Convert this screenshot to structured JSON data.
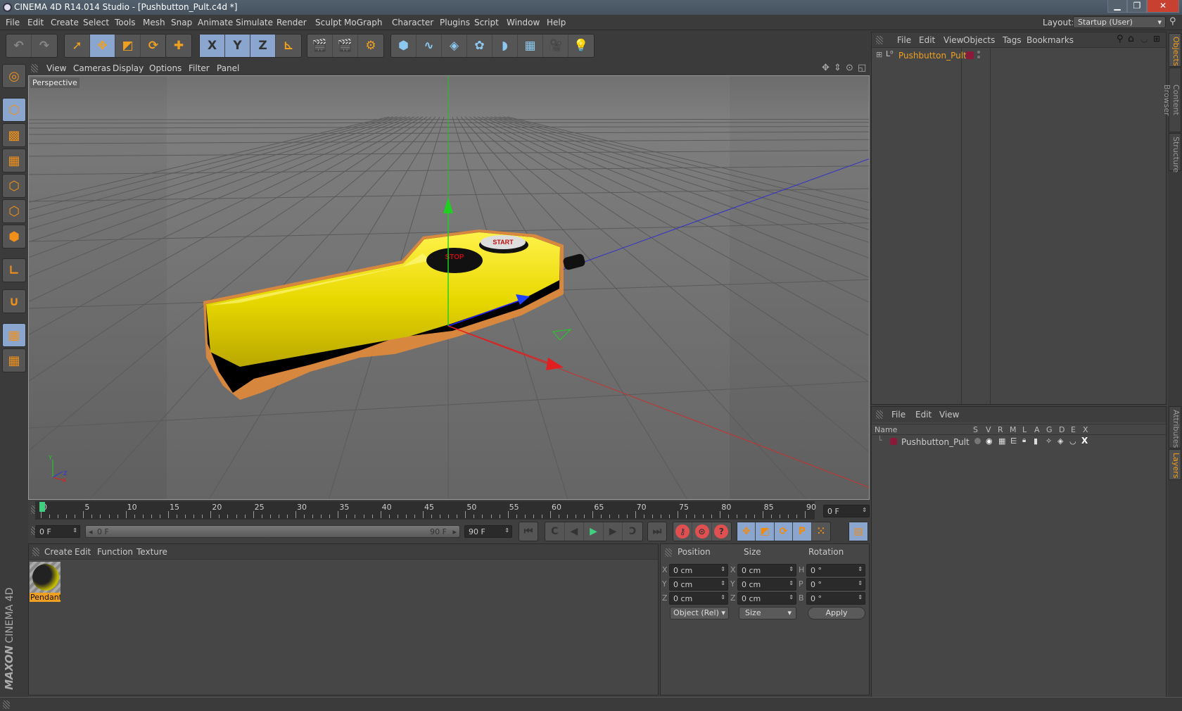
{
  "window": {
    "title": "CINEMA 4D R14.014 Studio - [Pushbutton_Pult.c4d *]",
    "minimize": "▁",
    "restore": "❐",
    "close": "✕"
  },
  "menubar": [
    "File",
    "Edit",
    "Create",
    "Select",
    "Tools",
    "Mesh",
    "Snap",
    "Animate",
    "Simulate",
    "Render",
    "Sculpt",
    "MoGraph",
    "Character",
    "Plugins",
    "Script",
    "Window",
    "Help"
  ],
  "layout": {
    "label": "Layout:",
    "value": "Startup (User)"
  },
  "toolbar": {
    "undo_group": [
      {
        "name": "undo-icon",
        "glyph": "↶"
      },
      {
        "name": "redo-icon",
        "glyph": "↷"
      }
    ],
    "transform_group": [
      {
        "name": "live-selection-icon",
        "glyph": "➚",
        "selected": false
      },
      {
        "name": "move-icon",
        "glyph": "✥",
        "selected": true
      },
      {
        "name": "scale-icon",
        "glyph": "◩",
        "selected": false
      },
      {
        "name": "rotate-icon",
        "glyph": "⟳",
        "selected": false
      }
    ],
    "last_tool": [
      {
        "name": "last-tool-icon",
        "glyph": "✚"
      }
    ],
    "axis_group": [
      {
        "name": "x-axis-lock-icon",
        "glyph": "X",
        "selected": true
      },
      {
        "name": "y-axis-lock-icon",
        "glyph": "Y",
        "selected": true
      },
      {
        "name": "z-axis-lock-icon",
        "glyph": "Z",
        "selected": true
      },
      {
        "name": "coordinate-system-icon",
        "glyph": "⊾",
        "selected": false
      }
    ],
    "render_group": [
      {
        "name": "render-view-icon",
        "glyph": "🎬"
      },
      {
        "name": "render-picture-viewer-icon",
        "glyph": "🎬"
      },
      {
        "name": "render-settings-icon",
        "glyph": "⚙"
      }
    ],
    "object_group": [
      {
        "name": "cube-icon",
        "glyph": "⬢"
      },
      {
        "name": "spline-pen-icon",
        "glyph": "∿"
      },
      {
        "name": "subdivision-icon",
        "glyph": "◈"
      },
      {
        "name": "array-icon",
        "glyph": "✿"
      },
      {
        "name": "deformer-icon",
        "glyph": "◗"
      },
      {
        "name": "floor-icon",
        "glyph": "▦"
      },
      {
        "name": "camera-icon",
        "glyph": "🎥"
      },
      {
        "name": "light-icon",
        "glyph": "💡"
      }
    ]
  },
  "left_toolbar": [
    {
      "name": "make-editable-icon",
      "glyph": "◎",
      "selected": false
    },
    {
      "name": "model-mode-icon",
      "glyph": "⬡",
      "selected": true
    },
    {
      "name": "texture-mode-icon",
      "glyph": "▩",
      "selected": false
    },
    {
      "name": "workplane-mode-icon",
      "glyph": "▦",
      "selected": false
    },
    {
      "name": "points-mode-icon",
      "glyph": "⬡",
      "selected": false
    },
    {
      "name": "edges-mode-icon",
      "glyph": "⬡",
      "selected": false
    },
    {
      "name": "polygons-mode-icon",
      "glyph": "⬢",
      "selected": false
    },
    {
      "name": "axis-mode-icon",
      "glyph": "∟",
      "selected": false
    },
    {
      "name": "snap-magnet-icon",
      "glyph": "∪",
      "selected": false
    },
    {
      "name": "locked-workplane-icon",
      "glyph": "▦",
      "selected": true
    },
    {
      "name": "planar-workplane-icon",
      "glyph": "▦",
      "selected": false
    }
  ],
  "viewport": {
    "menu": [
      "View",
      "Cameras",
      "Display",
      "Options",
      "Filter",
      "Panel"
    ],
    "label": "Perspective",
    "axis_labels": {
      "x": "X",
      "y": "Y",
      "z": "Z"
    }
  },
  "timeline": {
    "ticks": [
      "0",
      "5",
      "10",
      "15",
      "20",
      "25",
      "30",
      "35",
      "40",
      "45",
      "50",
      "55",
      "60",
      "65",
      "70",
      "75",
      "80",
      "85",
      "90"
    ],
    "current_frame": "0 F",
    "start_field": "0 F",
    "range_start": "0 F",
    "range_end": "90 F",
    "end_field": "90 F",
    "max_frame": 90,
    "current": 0
  },
  "playback": {
    "buttons": [
      {
        "name": "go-to-start-icon",
        "glyph": "⏮"
      },
      {
        "name": "previous-key-icon",
        "glyph": "C"
      },
      {
        "name": "previous-frame-icon",
        "glyph": "◀"
      },
      {
        "name": "play-icon",
        "glyph": "▶"
      },
      {
        "name": "next-frame-icon",
        "glyph": "▶"
      },
      {
        "name": "next-key-icon",
        "glyph": "Ↄ"
      },
      {
        "name": "go-to-end-icon",
        "glyph": "⏭"
      }
    ],
    "record": [
      {
        "name": "record-key-icon",
        "glyph": "⚷"
      },
      {
        "name": "autokey-icon",
        "glyph": "⊙"
      },
      {
        "name": "keyframe-selection-icon",
        "glyph": "?"
      }
    ],
    "key_tracks": [
      {
        "name": "key-position-icon",
        "glyph": "✥"
      },
      {
        "name": "key-scale-icon",
        "glyph": "◩"
      },
      {
        "name": "key-rotation-icon",
        "glyph": "⟳"
      },
      {
        "name": "key-parameter-icon",
        "glyph": "P"
      },
      {
        "name": "key-pla-icon",
        "glyph": "⁙"
      }
    ],
    "timeline_icon": {
      "name": "timeline-window-icon",
      "glyph": "▤"
    }
  },
  "material_manager": {
    "menu": [
      "Create",
      "Edit",
      "Function",
      "Texture"
    ],
    "materials": [
      {
        "name": "Pendant"
      }
    ]
  },
  "coordinates": {
    "headers": [
      "Position",
      "Size",
      "Rotation"
    ],
    "rows": [
      {
        "pos_axis": "X",
        "pos": "0 cm",
        "size_axis": "X",
        "size": "0 cm",
        "rot_axis": "H",
        "rot": "0 °"
      },
      {
        "pos_axis": "Y",
        "pos": "0 cm",
        "size_axis": "Y",
        "size": "0 cm",
        "rot_axis": "P",
        "rot": "0 °"
      },
      {
        "pos_axis": "Z",
        "pos": "0 cm",
        "size_axis": "Z",
        "size": "0 cm",
        "rot_axis": "B",
        "rot": "0 °"
      }
    ],
    "mode_select": "Object (Rel)",
    "size_select": "Size",
    "apply": "Apply"
  },
  "object_manager": {
    "menu": [
      "File",
      "Edit",
      "View",
      "Objects",
      "Tags",
      "Bookmarks"
    ],
    "objects": [
      {
        "name": "Pushbutton_Pult",
        "layer_color": "#8b1a3a"
      }
    ]
  },
  "layer_manager": {
    "menu": [
      "File",
      "Edit",
      "View"
    ],
    "columns": [
      "Name",
      "S",
      "V",
      "R",
      "M",
      "L",
      "A",
      "G",
      "D",
      "E",
      "X"
    ],
    "layers": [
      {
        "name": "Pushbutton_Pult",
        "color": "#8b1a3a"
      }
    ]
  },
  "side_tabs": {
    "top": [
      {
        "label": "Objects",
        "active": true
      },
      {
        "label": "Content Browser",
        "active": false
      },
      {
        "label": "Structure",
        "active": false
      }
    ],
    "bottom": [
      {
        "label": "Attributes",
        "active": false
      },
      {
        "label": "Layers",
        "active": true
      }
    ]
  },
  "branding": {
    "maxon": "MAXON",
    "product": "CINEMA 4D"
  },
  "colors": {
    "accent": "#f0a020",
    "selection_blue": "#8aa6cf",
    "play_green": "#40d080"
  }
}
